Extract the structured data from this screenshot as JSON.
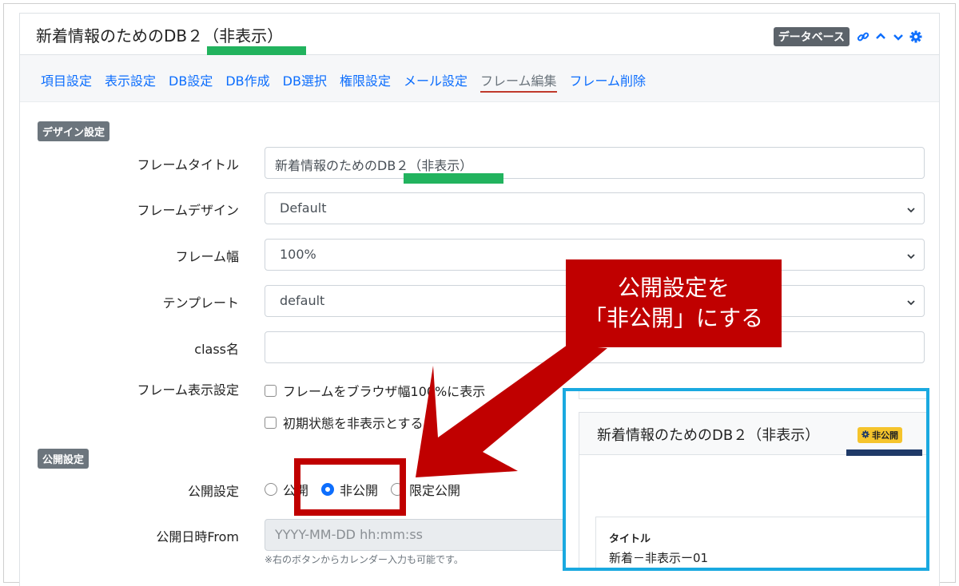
{
  "header": {
    "title": "新着情報のためのDB２（非表示）",
    "badge": "データベース",
    "icons": [
      "link-icon",
      "chevron-up-icon",
      "chevron-down-icon",
      "gear-icon"
    ]
  },
  "tabs": [
    {
      "label": "項目設定"
    },
    {
      "label": "表示設定"
    },
    {
      "label": "DB設定"
    },
    {
      "label": "DB作成"
    },
    {
      "label": "DB選択"
    },
    {
      "label": "権限設定"
    },
    {
      "label": "メール設定"
    },
    {
      "label": "フレーム編集",
      "active": true
    },
    {
      "label": "フレーム削除"
    }
  ],
  "design": {
    "section_label": "デザイン設定",
    "frame_title": {
      "label": "フレームタイトル",
      "value": "新着情報のためのDB２（非表示）"
    },
    "frame_design": {
      "label": "フレームデザイン",
      "value": "Default"
    },
    "frame_width": {
      "label": "フレーム幅",
      "value": "100%"
    },
    "template": {
      "label": "テンプレート",
      "value": "default"
    },
    "class_name": {
      "label": "class名",
      "value": ""
    },
    "frame_display": {
      "label": "フレーム表示設定",
      "option1": "フレームをブラウザ幅100%に表示",
      "option2": "初期状態を非表示とする"
    }
  },
  "publish": {
    "section_label": "公開設定",
    "label": "公開設定",
    "options": [
      {
        "label": "公開",
        "checked": false
      },
      {
        "label": "非公開",
        "checked": true
      },
      {
        "label": "限定公開",
        "checked": false
      }
    ],
    "from_label": "公開日時From",
    "from_placeholder": "YYYY-MM-DD hh:mm:ss",
    "hint": "※右のボタンからカレンダー入力も可能です。"
  },
  "callout": {
    "line1": "公開設定を",
    "line2": "「非公開」にする"
  },
  "inset": {
    "title": "新着情報のためのDB２（非表示）",
    "badge": "非公開",
    "card_label": "タイトル",
    "card_value": "新着－非表示ー01"
  },
  "colors": {
    "accent": "#0d6efd",
    "annotation_red": "#c00000",
    "annotation_green": "#22b35e",
    "inset_border": "#1aa9e0",
    "badge_yellow": "#f5c42c"
  }
}
